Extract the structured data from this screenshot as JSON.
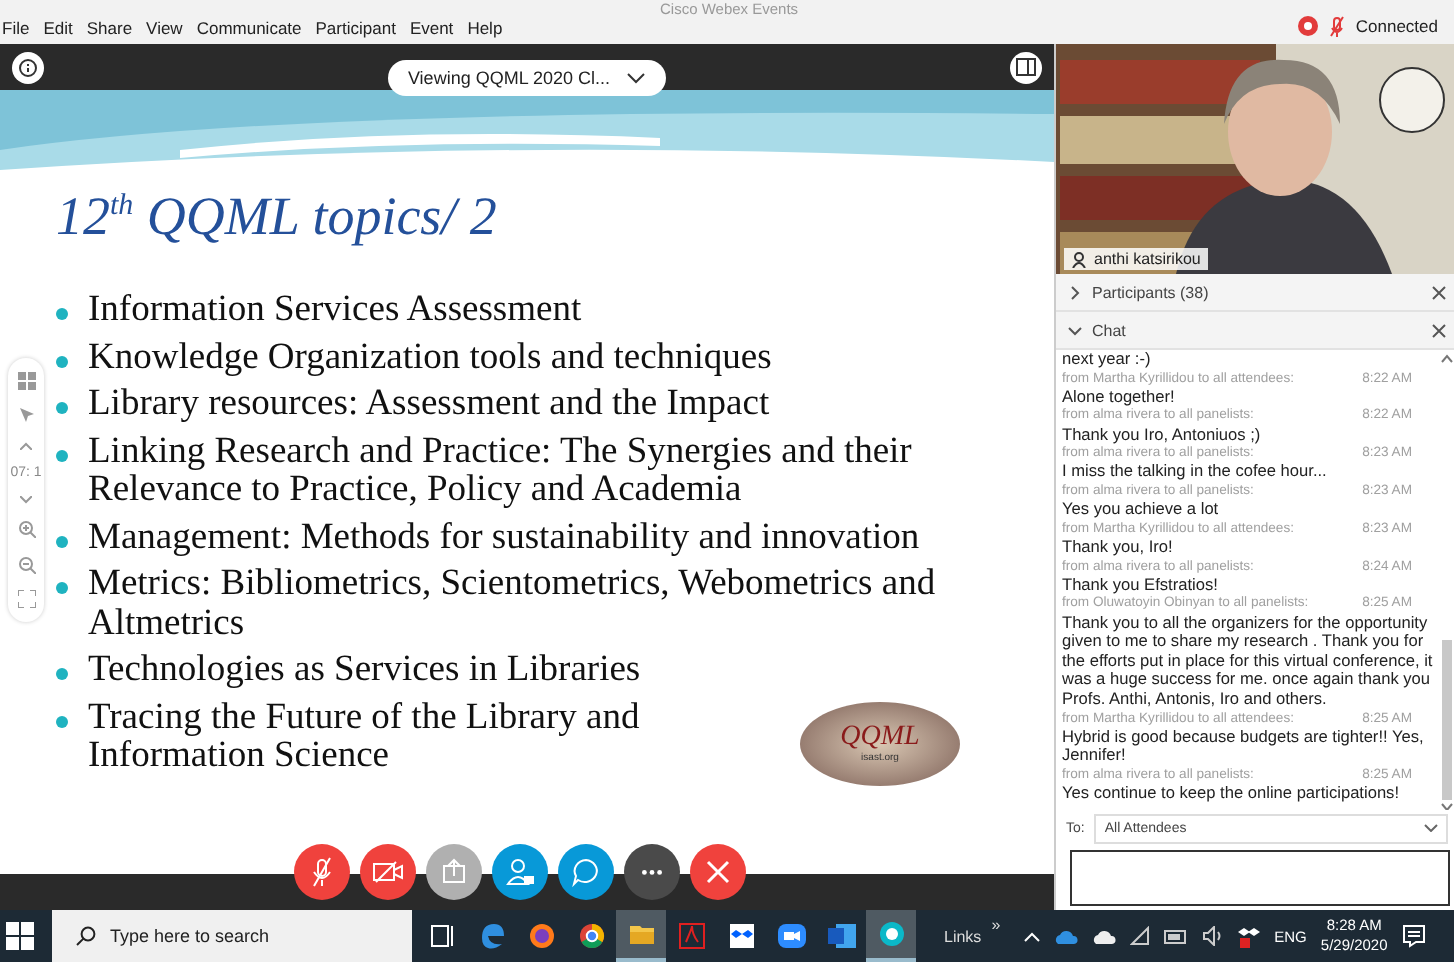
{
  "window": {
    "title": "Cisco Webex Events"
  },
  "menu": [
    "File",
    "Edit",
    "Share",
    "View",
    "Communicate",
    "Participant",
    "Event",
    "Help"
  ],
  "connection": {
    "label": "Connected"
  },
  "stage": {
    "viewing": "Viewing QQML 2020 Cl...",
    "zoom_level": "07: 1",
    "slide": {
      "title": "12$^{th}$ QQML topics/ 2",
      "bullets": [
        "Information Services Assessment",
        "Knowledge Organization tools and techniques",
        "Library resources: Assessment and the Impact",
        "Linking Research and Practice: The Synergies and their Relevance to Practice, Policy and Academia",
        "Management: Methods for sustainability and innovation",
        "Metrics: Bibliometrics, Scientometrics, Webometrics and Altmetrics",
        "Technologies as Services in Libraries",
        "Tracing the Future of the Library and Information Science"
      ],
      "logo": {
        "title": "QQML",
        "subtitle": "isast.org"
      }
    },
    "controls": [
      {
        "kind": "mic",
        "disabled": false
      },
      {
        "kind": "video",
        "disabled": false
      },
      {
        "kind": "share",
        "disabled": true
      },
      {
        "kind": "participants",
        "disabled": false
      },
      {
        "kind": "chat",
        "disabled": false
      },
      {
        "kind": "more",
        "disabled": false
      },
      {
        "kind": "leave",
        "disabled": false
      }
    ]
  },
  "video": {
    "kind": "picture",
    "name": "anthi katsirikou"
  },
  "panels": [
    {
      "title": "Participants (38)",
      "expanded": false
    },
    {
      "title": "Chat",
      "expanded": true
    }
  ],
  "chat": {
    "messages": [
      {
        "text": "next year :-)"
      },
      {
        "from": "from Martha Kyrillidou to all attendees:",
        "time": "8:22 AM",
        "text": "Alone together!"
      },
      {
        "from": "from alma rivera to all panelists:",
        "time": "8:22 AM",
        "text": "Thank you Iro, Antoniuos ;)"
      },
      {
        "from": "from alma rivera to all panelists:",
        "time": "8:23 AM",
        "text": "I miss the talking in the cofee hour..."
      },
      {
        "from": "from alma rivera to all panelists:",
        "time": "8:23 AM",
        "text": "Yes you achieve a lot"
      },
      {
        "from": "from Martha Kyrillidou to all attendees:",
        "time": "8:23 AM",
        "text": "Thank you, Iro!"
      },
      {
        "from": "from alma rivera to all panelists:",
        "time": "8:24 AM",
        "text": "Thank you Efstratios!"
      },
      {
        "from": "from Oluwatoyin Obinyan to all panelists:",
        "time": "8:25 AM",
        "text": "Thank you to all the organizers for the opportunity given to me to share my research . Thank you for the efforts put in place for this virtual conference, it was a huge success for me. once again thank you Profs. Anthi, Antonis, Iro and others."
      },
      {
        "from": "from Martha Kyrillidou to all attendees:",
        "time": "8:25 AM",
        "text": "Hybrid is good because budgets are tighter!! Yes, Jennifer!"
      },
      {
        "from": "from alma rivera to all panelists:",
        "time": "8:25 AM",
        "text": "Yes continue to keep the online participations!"
      }
    ],
    "to": {
      "label": "To:",
      "value": "All Attendees"
    }
  },
  "taskbar": {
    "search_placeholder": "Type here to search",
    "apps": [
      {
        "kind": "taskview",
        "active": false
      },
      {
        "kind": "edge",
        "active": false
      },
      {
        "kind": "firefox",
        "active": false
      },
      {
        "kind": "chrome",
        "active": false
      },
      {
        "kind": "folder",
        "active": true
      },
      {
        "kind": "pdf",
        "active": false
      },
      {
        "kind": "dropbox",
        "active": false
      },
      {
        "kind": "zoom",
        "active": false
      },
      {
        "kind": "word",
        "active": false
      },
      {
        "kind": "webex",
        "active": true
      }
    ],
    "links": "Links",
    "chevron": "»",
    "language": "ENG",
    "time": "8:28 AM",
    "date": "5/29/2020"
  }
}
